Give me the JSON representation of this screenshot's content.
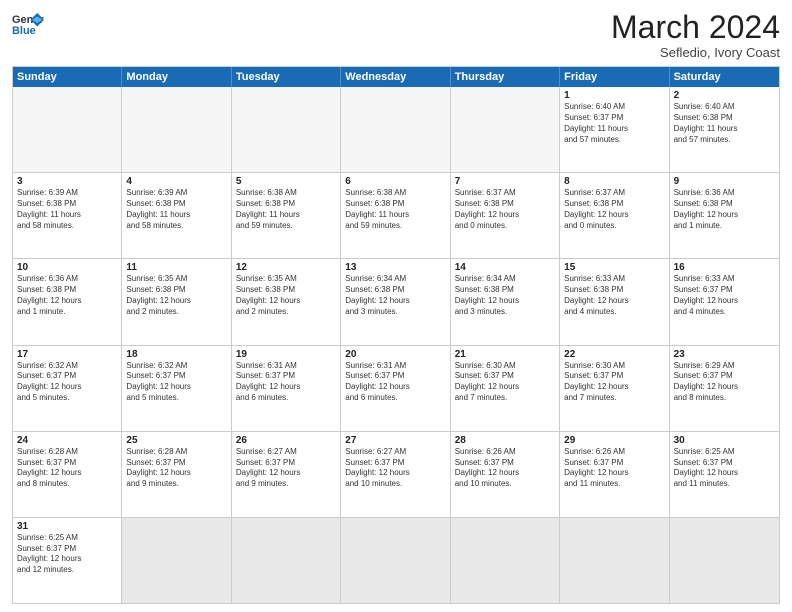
{
  "header": {
    "logo_general": "General",
    "logo_blue": "Blue",
    "month_title": "March 2024",
    "subtitle": "Sefledio, Ivory Coast"
  },
  "weekdays": [
    "Sunday",
    "Monday",
    "Tuesday",
    "Wednesday",
    "Thursday",
    "Friday",
    "Saturday"
  ],
  "rows": [
    [
      {
        "day": "",
        "info": ""
      },
      {
        "day": "",
        "info": ""
      },
      {
        "day": "",
        "info": ""
      },
      {
        "day": "",
        "info": ""
      },
      {
        "day": "",
        "info": ""
      },
      {
        "day": "1",
        "info": "Sunrise: 6:40 AM\nSunset: 6:37 PM\nDaylight: 11 hours\nand 57 minutes."
      },
      {
        "day": "2",
        "info": "Sunrise: 6:40 AM\nSunset: 6:38 PM\nDaylight: 11 hours\nand 57 minutes."
      }
    ],
    [
      {
        "day": "3",
        "info": "Sunrise: 6:39 AM\nSunset: 6:38 PM\nDaylight: 11 hours\nand 58 minutes."
      },
      {
        "day": "4",
        "info": "Sunrise: 6:39 AM\nSunset: 6:38 PM\nDaylight: 11 hours\nand 58 minutes."
      },
      {
        "day": "5",
        "info": "Sunrise: 6:38 AM\nSunset: 6:38 PM\nDaylight: 11 hours\nand 59 minutes."
      },
      {
        "day": "6",
        "info": "Sunrise: 6:38 AM\nSunset: 6:38 PM\nDaylight: 11 hours\nand 59 minutes."
      },
      {
        "day": "7",
        "info": "Sunrise: 6:37 AM\nSunset: 6:38 PM\nDaylight: 12 hours\nand 0 minutes."
      },
      {
        "day": "8",
        "info": "Sunrise: 6:37 AM\nSunset: 6:38 PM\nDaylight: 12 hours\nand 0 minutes."
      },
      {
        "day": "9",
        "info": "Sunrise: 6:36 AM\nSunset: 6:38 PM\nDaylight: 12 hours\nand 1 minute."
      }
    ],
    [
      {
        "day": "10",
        "info": "Sunrise: 6:36 AM\nSunset: 6:38 PM\nDaylight: 12 hours\nand 1 minute."
      },
      {
        "day": "11",
        "info": "Sunrise: 6:35 AM\nSunset: 6:38 PM\nDaylight: 12 hours\nand 2 minutes."
      },
      {
        "day": "12",
        "info": "Sunrise: 6:35 AM\nSunset: 6:38 PM\nDaylight: 12 hours\nand 2 minutes."
      },
      {
        "day": "13",
        "info": "Sunrise: 6:34 AM\nSunset: 6:38 PM\nDaylight: 12 hours\nand 3 minutes."
      },
      {
        "day": "14",
        "info": "Sunrise: 6:34 AM\nSunset: 6:38 PM\nDaylight: 12 hours\nand 3 minutes."
      },
      {
        "day": "15",
        "info": "Sunrise: 6:33 AM\nSunset: 6:38 PM\nDaylight: 12 hours\nand 4 minutes."
      },
      {
        "day": "16",
        "info": "Sunrise: 6:33 AM\nSunset: 6:37 PM\nDaylight: 12 hours\nand 4 minutes."
      }
    ],
    [
      {
        "day": "17",
        "info": "Sunrise: 6:32 AM\nSunset: 6:37 PM\nDaylight: 12 hours\nand 5 minutes."
      },
      {
        "day": "18",
        "info": "Sunrise: 6:32 AM\nSunset: 6:37 PM\nDaylight: 12 hours\nand 5 minutes."
      },
      {
        "day": "19",
        "info": "Sunrise: 6:31 AM\nSunset: 6:37 PM\nDaylight: 12 hours\nand 6 minutes."
      },
      {
        "day": "20",
        "info": "Sunrise: 6:31 AM\nSunset: 6:37 PM\nDaylight: 12 hours\nand 6 minutes."
      },
      {
        "day": "21",
        "info": "Sunrise: 6:30 AM\nSunset: 6:37 PM\nDaylight: 12 hours\nand 7 minutes."
      },
      {
        "day": "22",
        "info": "Sunrise: 6:30 AM\nSunset: 6:37 PM\nDaylight: 12 hours\nand 7 minutes."
      },
      {
        "day": "23",
        "info": "Sunrise: 6:29 AM\nSunset: 6:37 PM\nDaylight: 12 hours\nand 8 minutes."
      }
    ],
    [
      {
        "day": "24",
        "info": "Sunrise: 6:28 AM\nSunset: 6:37 PM\nDaylight: 12 hours\nand 8 minutes."
      },
      {
        "day": "25",
        "info": "Sunrise: 6:28 AM\nSunset: 6:37 PM\nDaylight: 12 hours\nand 9 minutes."
      },
      {
        "day": "26",
        "info": "Sunrise: 6:27 AM\nSunset: 6:37 PM\nDaylight: 12 hours\nand 9 minutes."
      },
      {
        "day": "27",
        "info": "Sunrise: 6:27 AM\nSunset: 6:37 PM\nDaylight: 12 hours\nand 10 minutes."
      },
      {
        "day": "28",
        "info": "Sunrise: 6:26 AM\nSunset: 6:37 PM\nDaylight: 12 hours\nand 10 minutes."
      },
      {
        "day": "29",
        "info": "Sunrise: 6:26 AM\nSunset: 6:37 PM\nDaylight: 12 hours\nand 11 minutes."
      },
      {
        "day": "30",
        "info": "Sunrise: 6:25 AM\nSunset: 6:37 PM\nDaylight: 12 hours\nand 11 minutes."
      }
    ],
    [
      {
        "day": "31",
        "info": "Sunrise: 6:25 AM\nSunset: 6:37 PM\nDaylight: 12 hours\nand 12 minutes."
      },
      {
        "day": "",
        "info": ""
      },
      {
        "day": "",
        "info": ""
      },
      {
        "day": "",
        "info": ""
      },
      {
        "day": "",
        "info": ""
      },
      {
        "day": "",
        "info": ""
      },
      {
        "day": "",
        "info": ""
      }
    ]
  ]
}
